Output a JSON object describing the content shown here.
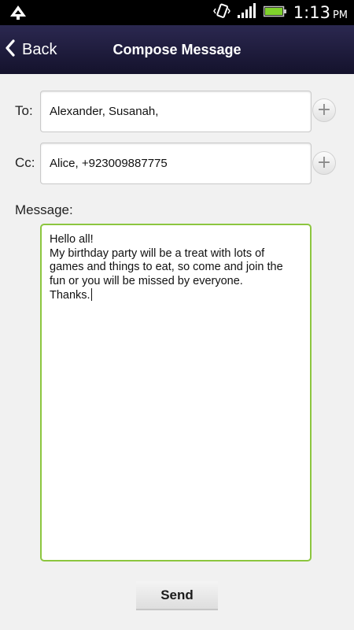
{
  "status_bar": {
    "time": "1:13",
    "ampm": "PM",
    "icons": [
      "app-notification-icon",
      "vibrate-icon",
      "signal-icon",
      "battery-icon"
    ]
  },
  "header": {
    "back_label": "Back",
    "title": "Compose Message"
  },
  "form": {
    "to_label": "To:",
    "to_value": "Alexander, Susanah,",
    "cc_label": "Cc:",
    "cc_value": "Alice, +923009887775",
    "message_label": "Message:",
    "message_value": "Hello all!\nMy birthday party will be a treat with lots of\ngames and things to eat, so come and join the\nfun or you will be missed by everyone.\nThanks."
  },
  "actions": {
    "send_label": "Send"
  },
  "colors": {
    "title_bar": "#1f1c3e",
    "focus_border": "#8cc63f",
    "battery": "#7fd12c",
    "background": "#f1f1f1"
  }
}
